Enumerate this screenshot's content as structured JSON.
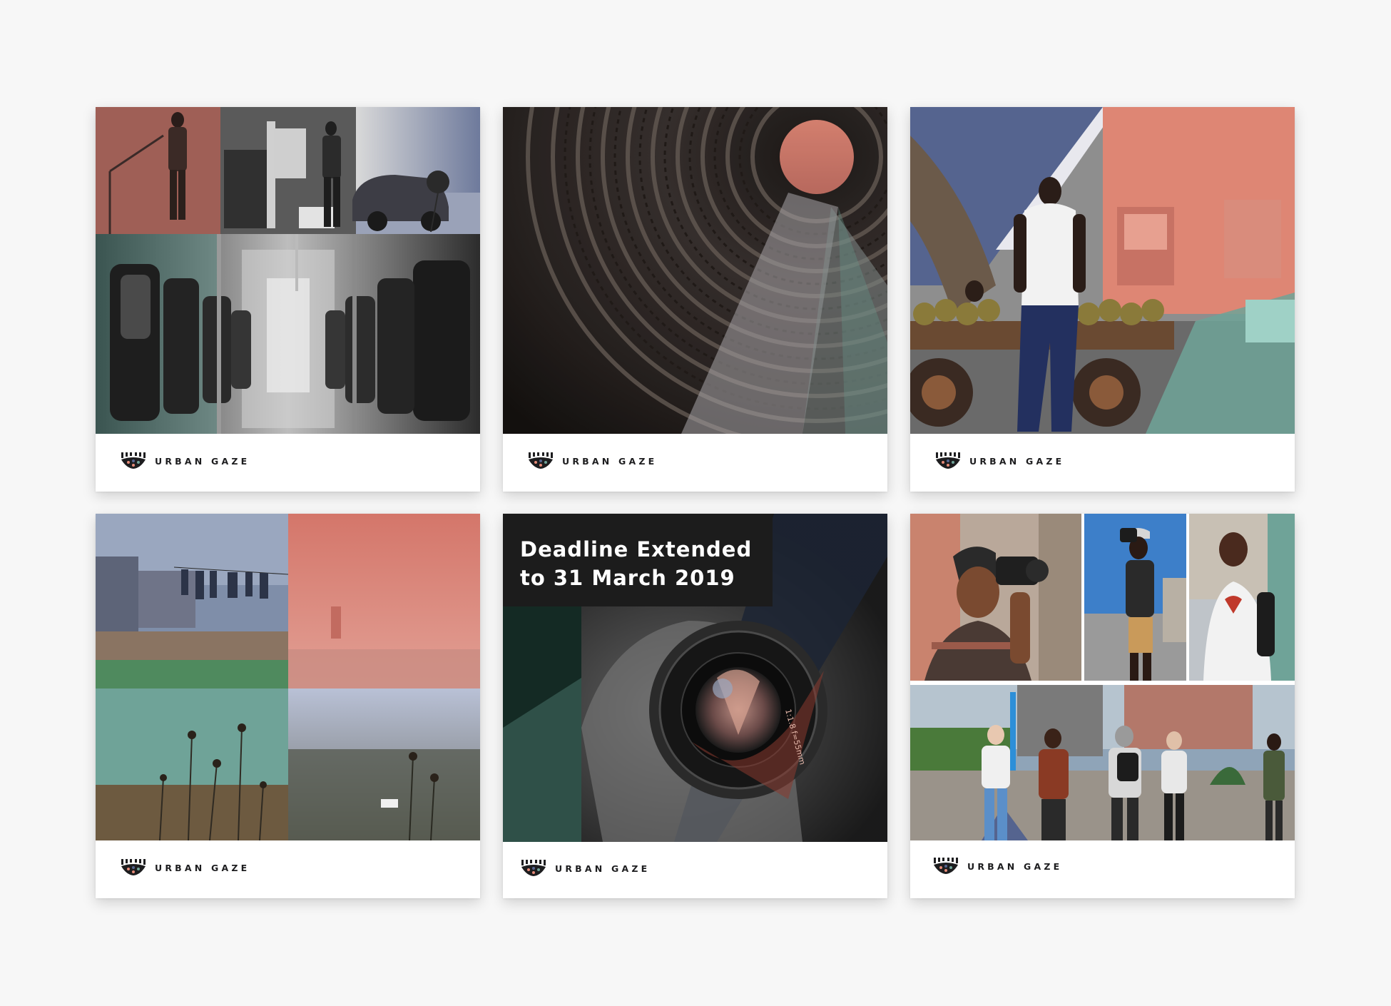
{
  "brand": {
    "name": "URBAN GAZE",
    "icon": "urban-gaze-eye-logo-icon"
  },
  "colors": {
    "background": "#f7f7f7",
    "coral": "#e58a78",
    "slate_blue": "#55648f",
    "teal": "#6fa398",
    "dark": "#1c1c1c"
  },
  "posts": [
    {
      "id": "post-1",
      "brand_label": "URBAN GAZE"
    },
    {
      "id": "post-2",
      "brand_label": "URBAN GAZE"
    },
    {
      "id": "post-3",
      "brand_label": "URBAN GAZE"
    },
    {
      "id": "post-4",
      "brand_label": "URBAN GAZE"
    },
    {
      "id": "post-5",
      "brand_label": "URBAN GAZE",
      "headline_line1": "Deadline Extended",
      "headline_line2": "to 31 March 2019"
    },
    {
      "id": "post-6",
      "brand_label": "URBAN GAZE"
    }
  ]
}
